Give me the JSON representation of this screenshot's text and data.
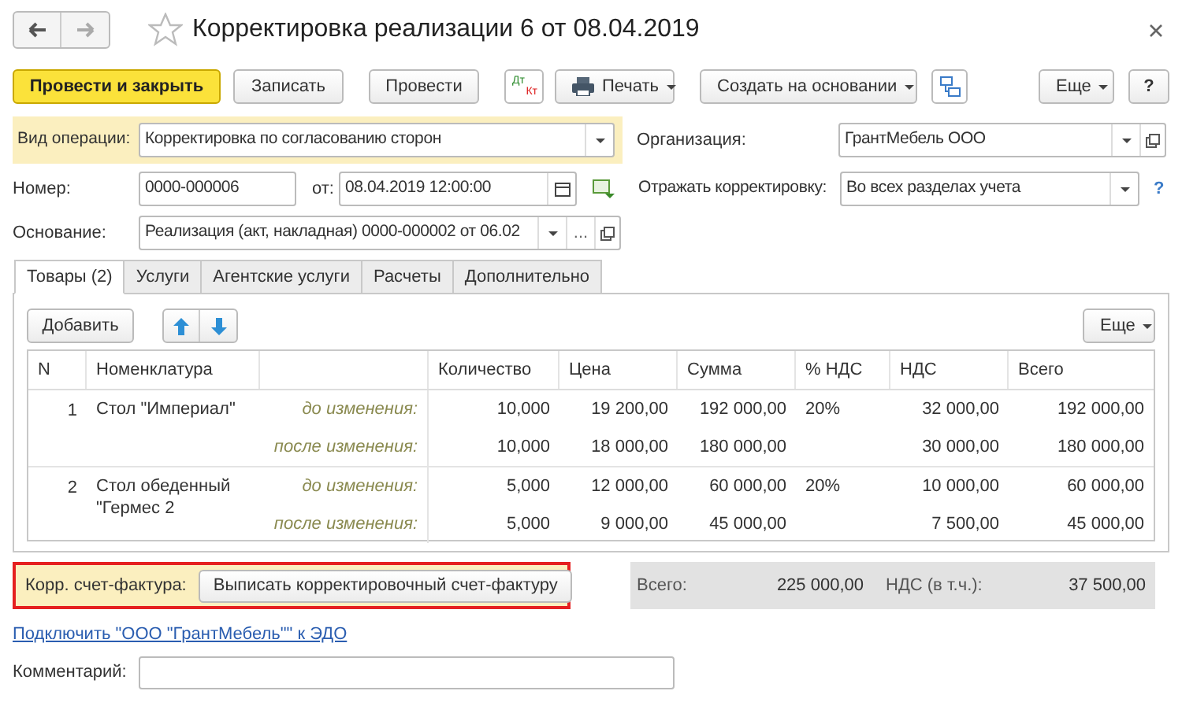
{
  "window": {
    "title": "Корректировка реализации 6 от 08.04.2019"
  },
  "toolbar": {
    "primary": "Провести и закрыть",
    "save": "Записать",
    "post": "Провести",
    "dt_kt": {
      "debit": "Дт",
      "credit": "Кт"
    },
    "print": "Печать",
    "create_based_on": "Создать на основании",
    "more": "Еще",
    "help": "?"
  },
  "form": {
    "operation_label": "Вид операции:",
    "operation_value": "Корректировка по согласованию сторон",
    "organization_label": "Организация:",
    "organization_value": "ГрантМебель ООО",
    "number_label": "Номер:",
    "number_value": "0000-000006",
    "date_label": "от:",
    "date_value": "08.04.2019 12:00:00",
    "reflect_label": "Отражать корректировку:",
    "reflect_value": "Во всех разделах учета",
    "reflect_help": "?",
    "basis_label": "Основание:",
    "basis_value": "Реализация (акт, накладная) 0000-000002 от 06.02",
    "basis_select": "..."
  },
  "tabs": [
    {
      "label": "Товары (2)",
      "selected": true
    },
    {
      "label": "Услуги",
      "selected": false
    },
    {
      "label": "Агентские услуги",
      "selected": false
    },
    {
      "label": "Расчеты",
      "selected": false
    },
    {
      "label": "Дополнительно",
      "selected": false
    }
  ],
  "table_toolbar": {
    "add": "Добавить",
    "more": "Еще"
  },
  "table": {
    "columns": [
      "N",
      "Номенклатура",
      "Количество",
      "Цена",
      "Сумма",
      "% НДС",
      "НДС",
      "Всего"
    ],
    "rows": [
      {
        "n": "1",
        "name": "Стол \"Империал\"",
        "lines": [
          {
            "stage": "до изменения:",
            "quantity": "10,000",
            "price": "19 200,00",
            "sum": "192 000,00",
            "vat_rate": "20%",
            "vat": "32 000,00",
            "total": "192 000,00"
          },
          {
            "stage": "после изменения:",
            "quantity": "10,000",
            "price": "18 000,00",
            "sum": "180 000,00",
            "vat": "30 000,00",
            "total": "180 000,00"
          }
        ]
      },
      {
        "n": "2",
        "name": "Стол обеденный \"Гермес 2",
        "lines": [
          {
            "stage": "до изменения:",
            "quantity": "5,000",
            "price": "12 000,00",
            "sum": "60 000,00",
            "vat_rate": "20%",
            "vat": "10 000,00",
            "total": "60 000,00"
          },
          {
            "stage": "после изменения:",
            "quantity": "5,000",
            "price": "9 000,00",
            "sum": "45 000,00",
            "vat": "7 500,00",
            "total": "45 000,00"
          }
        ]
      }
    ]
  },
  "invoice": {
    "label": "Корр. счет-фактура:",
    "button": "Выписать корректировочный счет-фактуру"
  },
  "totals": {
    "total_label": "Всего:",
    "total_value": "225 000,00",
    "vat_label": "НДС (в т.ч.):",
    "vat_value": "37 500,00"
  },
  "edo_link": "Подключить \"ООО \"ГрантМебель\"\" к ЭДО",
  "comment": {
    "label": "Комментарий:"
  }
}
